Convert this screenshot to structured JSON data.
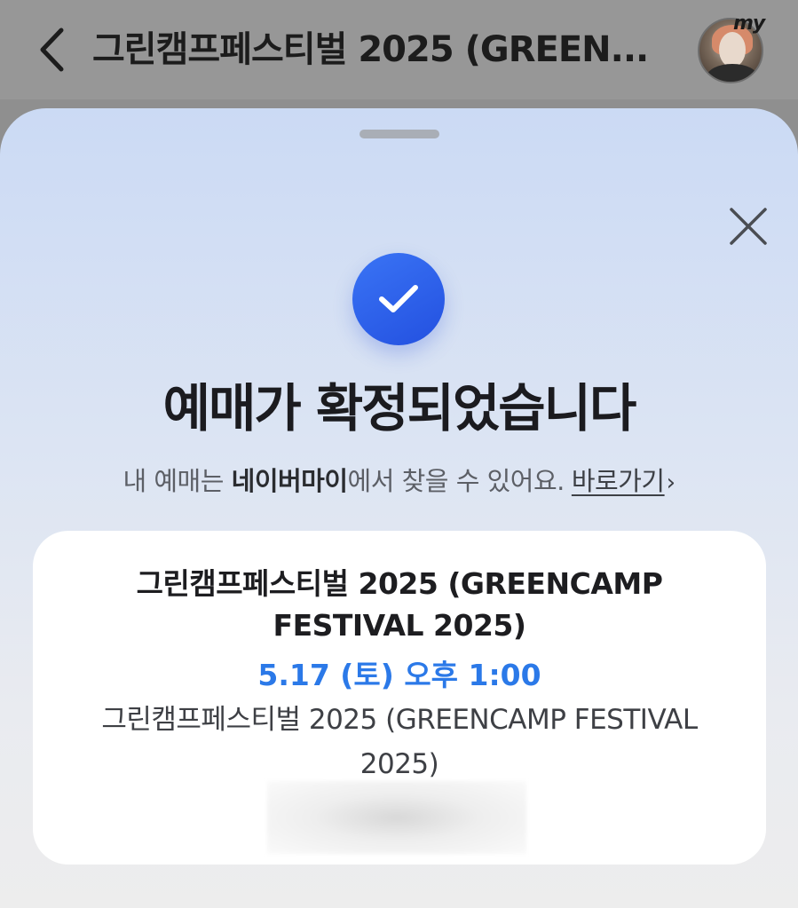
{
  "header": {
    "title": "그린캠프페스티벌 2025 (GREEN...",
    "avatar_badge": "my"
  },
  "sheet": {
    "headline": "예매가 확정되었습니다",
    "subline_prefix": "내 예매는 ",
    "subline_strong": "네이버마이",
    "subline_suffix": "에서 찾을 수 있어요.",
    "link_label": "바로가기",
    "link_arrow": "›"
  },
  "ticket": {
    "title": "그린캠프페스티벌 2025 (GREENCAMP FESTIVAL 2025)",
    "date_time": "5.17 (토) 오후 1:00",
    "venue": "그린캠프페스티벌 2025 (GREENCAMP FESTIVAL 2025)"
  },
  "colors": {
    "accent": "#2B79E8",
    "check_bg": "#2350E0",
    "headline": "#1B1B1F"
  },
  "icons": [
    "back-arrow-icon",
    "close-icon",
    "checkmark-icon"
  ]
}
